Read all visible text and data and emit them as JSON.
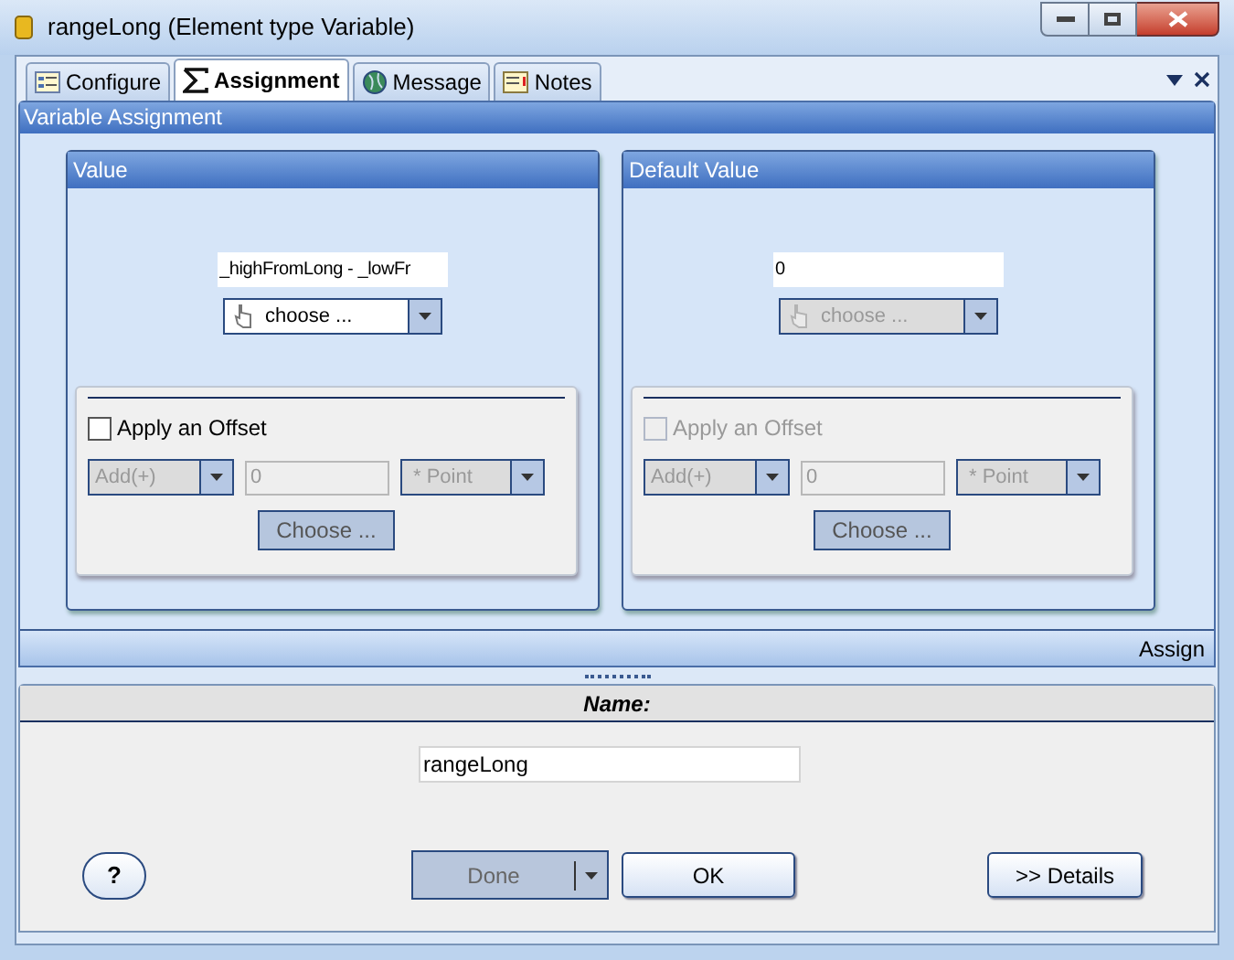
{
  "window": {
    "title": "rangeLong (Element type Variable)"
  },
  "tabs": [
    {
      "label": "Configure",
      "selected": false
    },
    {
      "label": "Assignment",
      "selected": true
    },
    {
      "label": "Message",
      "selected": false
    },
    {
      "label": "Notes",
      "selected": false
    }
  ],
  "section_title": "Variable Assignment",
  "panels": [
    {
      "title": "Value",
      "value": "_highFromLong - _lowFr",
      "chooser": {
        "label": "choose ...",
        "disabled": false
      },
      "offset": {
        "label": "Apply an Offset",
        "checked": false,
        "disabled": false,
        "operation": "Add(+)",
        "amount": "0",
        "unit": "* Point",
        "choose_label": "Choose ..."
      }
    },
    {
      "title": "Default Value",
      "value": "0",
      "chooser": {
        "label": "choose ...",
        "disabled": true
      },
      "offset": {
        "label": "Apply an Offset",
        "checked": false,
        "disabled": true,
        "operation": "Add(+)",
        "amount": "0",
        "unit": "* Point",
        "choose_label": "Choose ..."
      }
    }
  ],
  "footer_label": "Assign",
  "name_section": {
    "title": "Name:",
    "value": "rangeLong"
  },
  "buttons": {
    "help": "?",
    "done": {
      "label": "Done",
      "disabled": true
    },
    "ok": "OK",
    "details": ">> Details"
  }
}
